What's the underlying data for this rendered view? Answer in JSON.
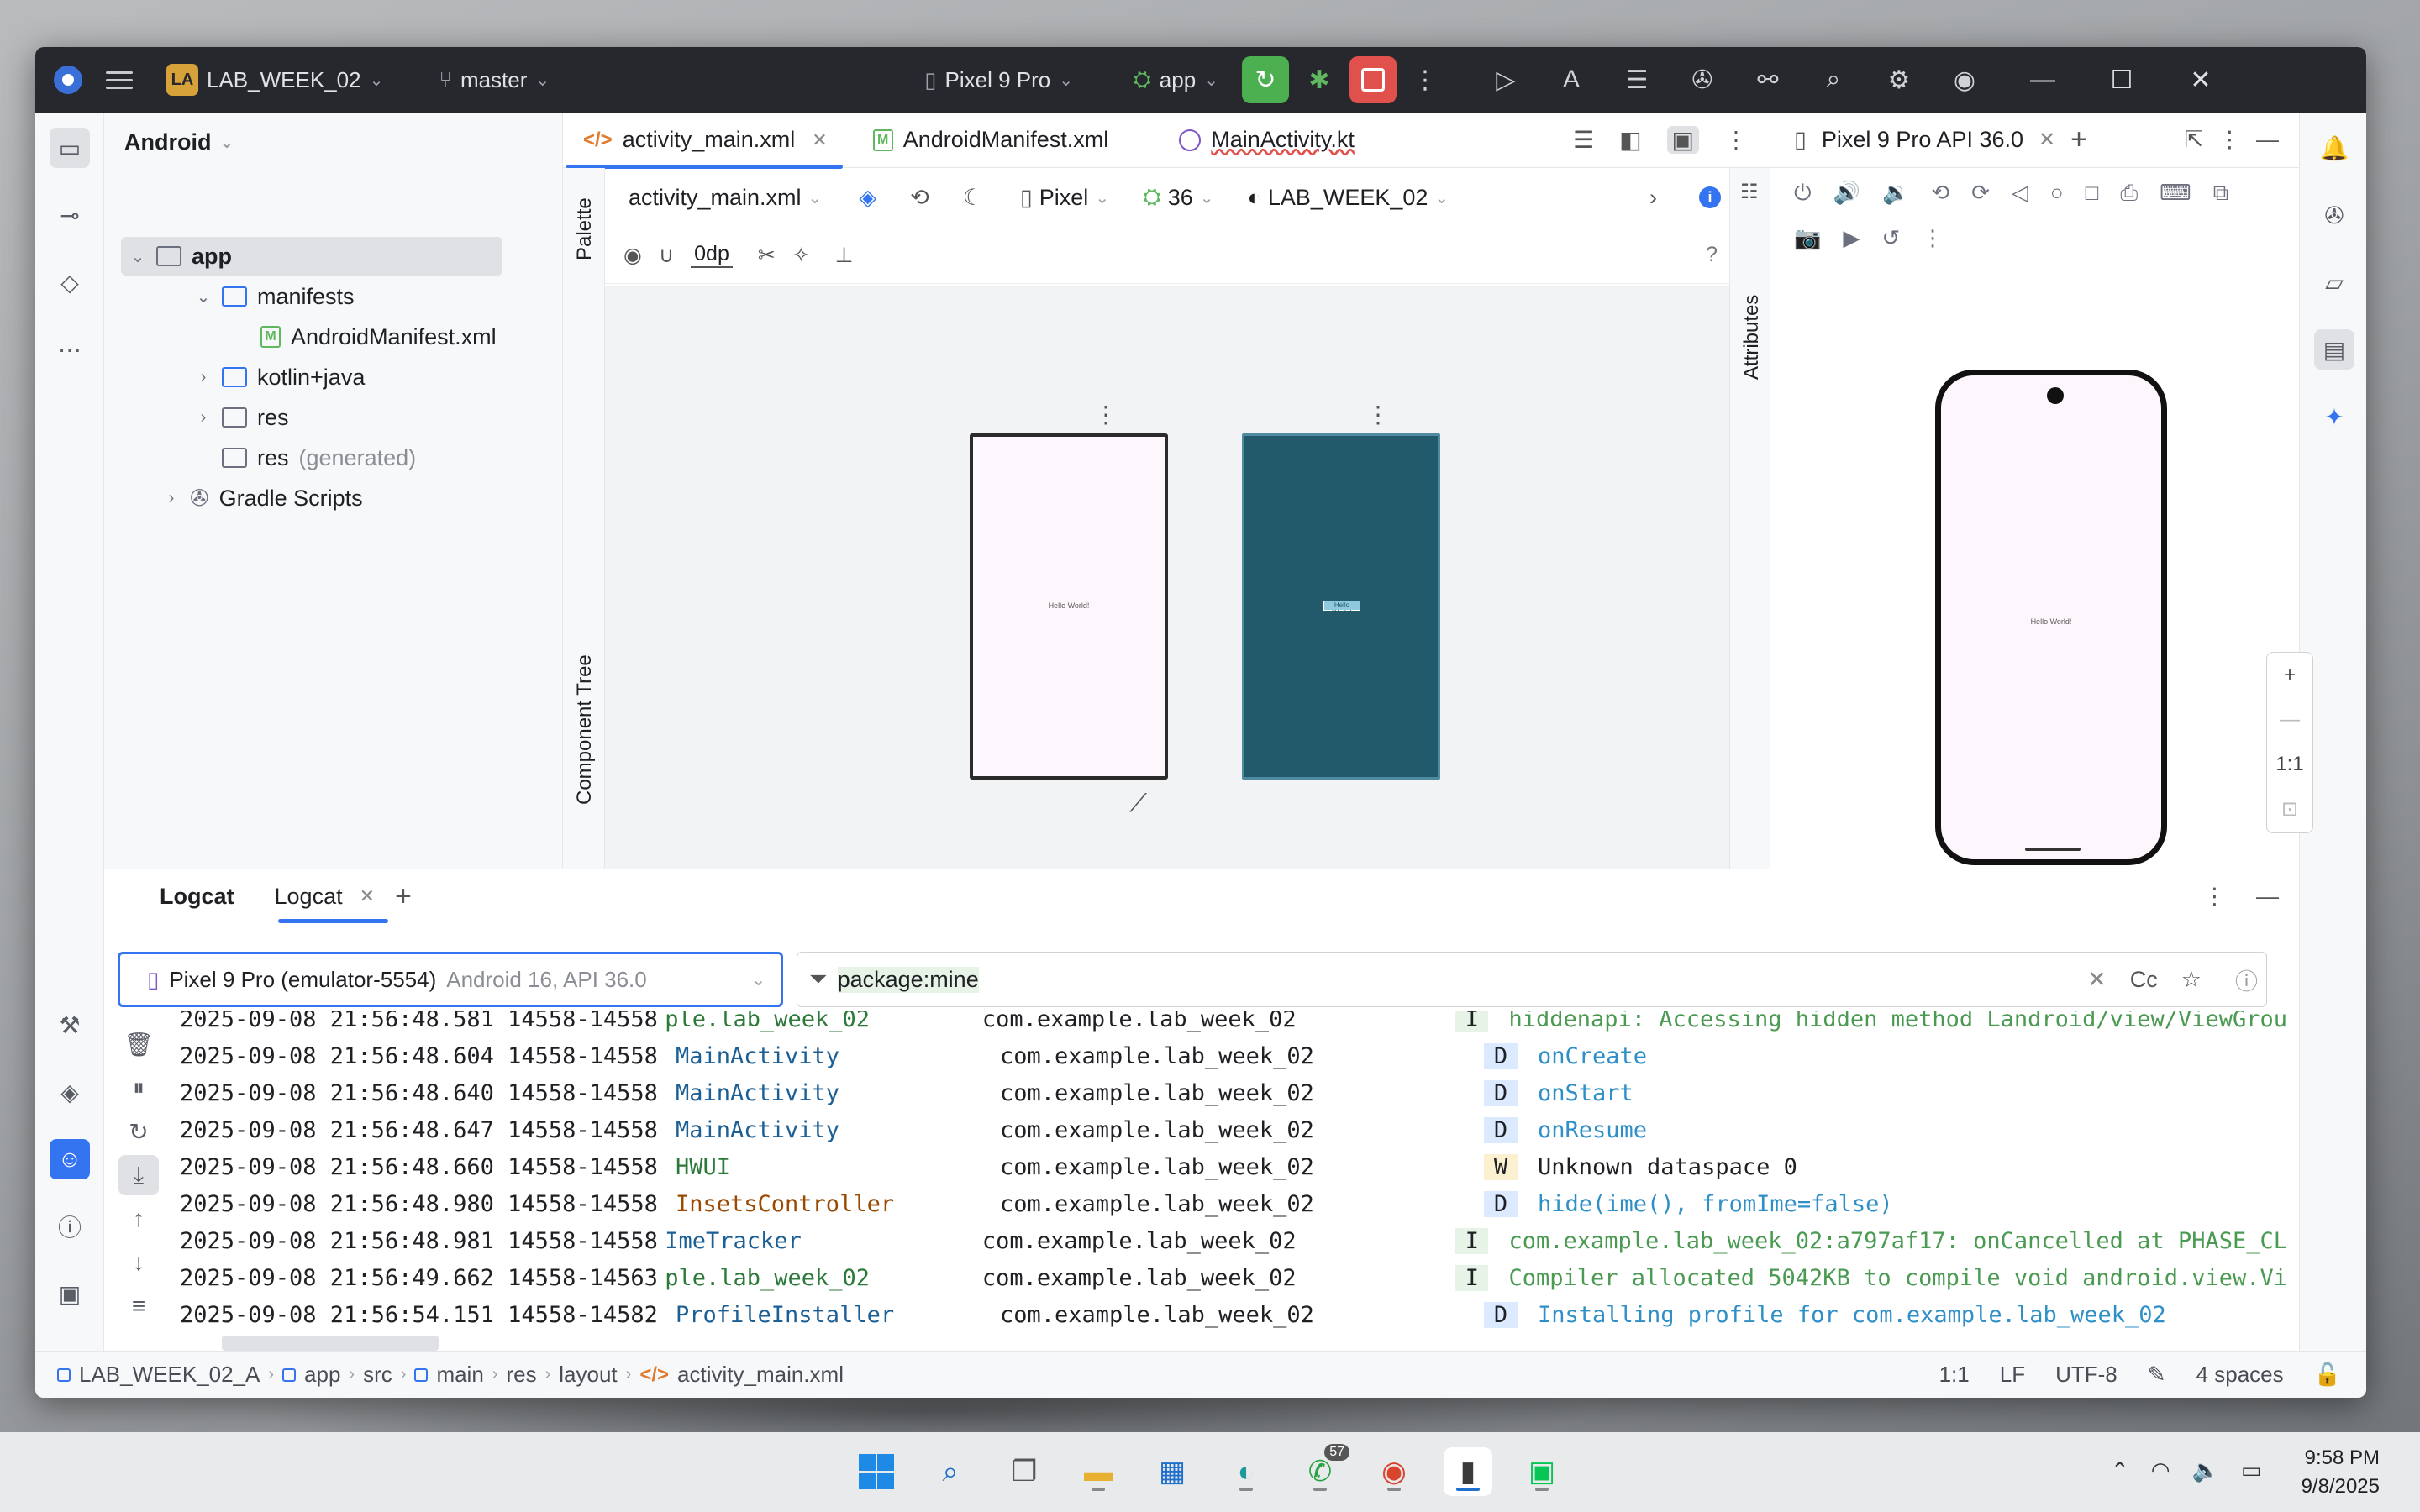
{
  "title_bar": {
    "project_badge": "LA",
    "project_name": "LAB_WEEK_02",
    "branch": "master",
    "device": "Pixel 9 Pro",
    "run_config": "app"
  },
  "project_panel": {
    "view_selector": "Android",
    "tree": [
      {
        "label": "app",
        "suffix": ""
      },
      {
        "label": "manifests",
        "suffix": ""
      },
      {
        "label": "AndroidManifest.xml",
        "suffix": ""
      },
      {
        "label": "kotlin+java",
        "suffix": ""
      },
      {
        "label": "res",
        "suffix": ""
      },
      {
        "label": "res",
        "suffix": "(generated)"
      },
      {
        "label": "Gradle Scripts",
        "suffix": ""
      }
    ]
  },
  "editor": {
    "tabs": [
      "activity_main.xml",
      "AndroidManifest.xml",
      "MainActivity.kt"
    ],
    "palette_label": "Palette",
    "component_tree_label": "Component Tree",
    "attributes_label": "Attributes",
    "file_select": "activity_main.xml",
    "device_select": "Pixel",
    "api_select": "36",
    "theme_select": "LAB_WEEK_02",
    "margin_value": "0dp",
    "preview_text": "Hello World!",
    "help": "?"
  },
  "running_devices": {
    "tab": "Pixel 9 Pro API 36.0",
    "zoom_ratio": "1:1",
    "screen_text": "Hello World!"
  },
  "logcat": {
    "title": "Logcat",
    "tab": "Logcat",
    "device_name": "Pixel 9 Pro (emulator-5554)",
    "device_api": "Android 16, API 36.0",
    "filter": "package:mine",
    "case_toggle": "Cc",
    "lines": [
      {
        "ts": "2025-09-08 21:56:48.581 14558-14558",
        "tag": "ple.lab_week_02",
        "pkg": "com.example.lab_week_02",
        "level": "I",
        "msg": "hiddenapi: Accessing hidden method Landroid/view/ViewGrou"
      },
      {
        "ts": "2025-09-08 21:56:48.604 14558-14558",
        "tag": "MainActivity",
        "pkg": "com.example.lab_week_02",
        "level": "D",
        "msg": "onCreate"
      },
      {
        "ts": "2025-09-08 21:56:48.640 14558-14558",
        "tag": "MainActivity",
        "pkg": "com.example.lab_week_02",
        "level": "D",
        "msg": "onStart"
      },
      {
        "ts": "2025-09-08 21:56:48.647 14558-14558",
        "tag": "MainActivity",
        "pkg": "com.example.lab_week_02",
        "level": "D",
        "msg": "onResume"
      },
      {
        "ts": "2025-09-08 21:56:48.660 14558-14558",
        "tag": "HWUI",
        "pkg": "com.example.lab_week_02",
        "level": "W",
        "msg": "Unknown dataspace 0"
      },
      {
        "ts": "2025-09-08 21:56:48.980 14558-14558",
        "tag": "InsetsController",
        "pkg": "com.example.lab_week_02",
        "level": "D",
        "msg": "hide(ime(), fromIme=false)"
      },
      {
        "ts": "2025-09-08 21:56:48.981 14558-14558",
        "tag": "ImeTracker",
        "pkg": "com.example.lab_week_02",
        "level": "I",
        "msg": "com.example.lab_week_02:a797af17: onCancelled at PHASE_CL"
      },
      {
        "ts": "2025-09-08 21:56:49.662 14558-14563",
        "tag": "ple.lab_week_02",
        "pkg": "com.example.lab_week_02",
        "level": "I",
        "msg": "Compiler allocated 5042KB to compile void android.view.Vi"
      },
      {
        "ts": "2025-09-08 21:56:54.151 14558-14582",
        "tag": "ProfileInstaller",
        "pkg": "com.example.lab_week_02",
        "level": "D",
        "msg": "Installing profile for com.example.lab_week_02"
      }
    ]
  },
  "status_bar": {
    "breadcrumb": [
      "LAB_WEEK_02_A",
      "app",
      "src",
      "main",
      "res",
      "layout",
      "activity_main.xml"
    ],
    "position": "1:1",
    "line_sep": "LF",
    "encoding": "UTF-8",
    "indent": "4 spaces"
  },
  "taskbar": {
    "whatsapp_badge": "57",
    "time": "9:58 PM",
    "date": "9/8/2025"
  },
  "colors": {
    "accent": "#3574f0",
    "titlebar": "#27282e",
    "run_green": "#4caf50",
    "stop_red": "#e0504c"
  }
}
